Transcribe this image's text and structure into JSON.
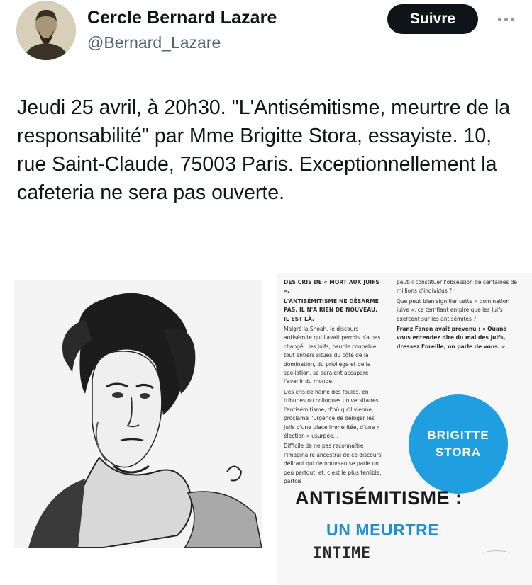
{
  "author": {
    "name": "Cercle Bernard Lazare",
    "handle": "@Bernard_Lazare"
  },
  "header": {
    "follow_label": "Suivre",
    "more_icon": "more-horizontal-icon"
  },
  "tweet": {
    "text": "Jeudi 25 avril, à 20h30. \"L'Antisémitisme, meurtre de la responsabilité\" par Mme Brigitte Stora, essayiste. 10, rue Saint-Claude, 75003 Paris. Exceptionnellement la cafeteria ne sera pas ouverte."
  },
  "media": {
    "portrait_alt": "portrait-sketch",
    "book": {
      "column_left": {
        "line1": "DES CRIS DE « MORT AUX JUIFS ».",
        "lead": "L'ANTISÉMITISME NE DÉSARME PAS, IL N'A RIEN DE NOUVEAU, IL EST LÀ.",
        "para1": "Malgré la Shoah, le discours antisémite qui l'avait permis n'a pas changé : les Juifs, peuple coupable, tout entiers situés du côté de la domination, du privilège et de la spoliation, se seraient accaparé l'avenir du monde.",
        "para2": "Des cris de haine des foules, en tribunes ou colloques universitaires, l'antisémitisme, d'où qu'il vienne, proclame l'urgence de déloger les Juifs d'une place imméritée, d'une « élection » usurpée…",
        "para3": "Difficile de ne pas reconnaître l'imaginaire ancestral de ce discours délirant qui de nouveau se parle un peu partout, et, c'est le plus terrible, parfois"
      },
      "column_right": {
        "para1": "peut-il constituer l'obsession de centaines de millions d'individus ?",
        "para2": "Que peut bien signifier cette « domination juive », ce terrifiant empire que les Juifs exercent sur les antisémites ?",
        "para3": "Franz Fanon avait prévenu : « Quand vous entendez dire du mal des juifs, dressez l'oreille, on parle de vous. »"
      },
      "author_badge_line1": "BRIGITTE",
      "author_badge_line2": "STORA",
      "title": "ANTISÉMITISME :",
      "subtitle_line1": "UN MEURTRE",
      "subtitle_line2": "INTIME"
    }
  },
  "colors": {
    "follow_bg": "#0f1419",
    "badge_blue": "#1f9ee0",
    "subtitle_blue": "#1f8fd0",
    "handle_gray": "#536471"
  }
}
